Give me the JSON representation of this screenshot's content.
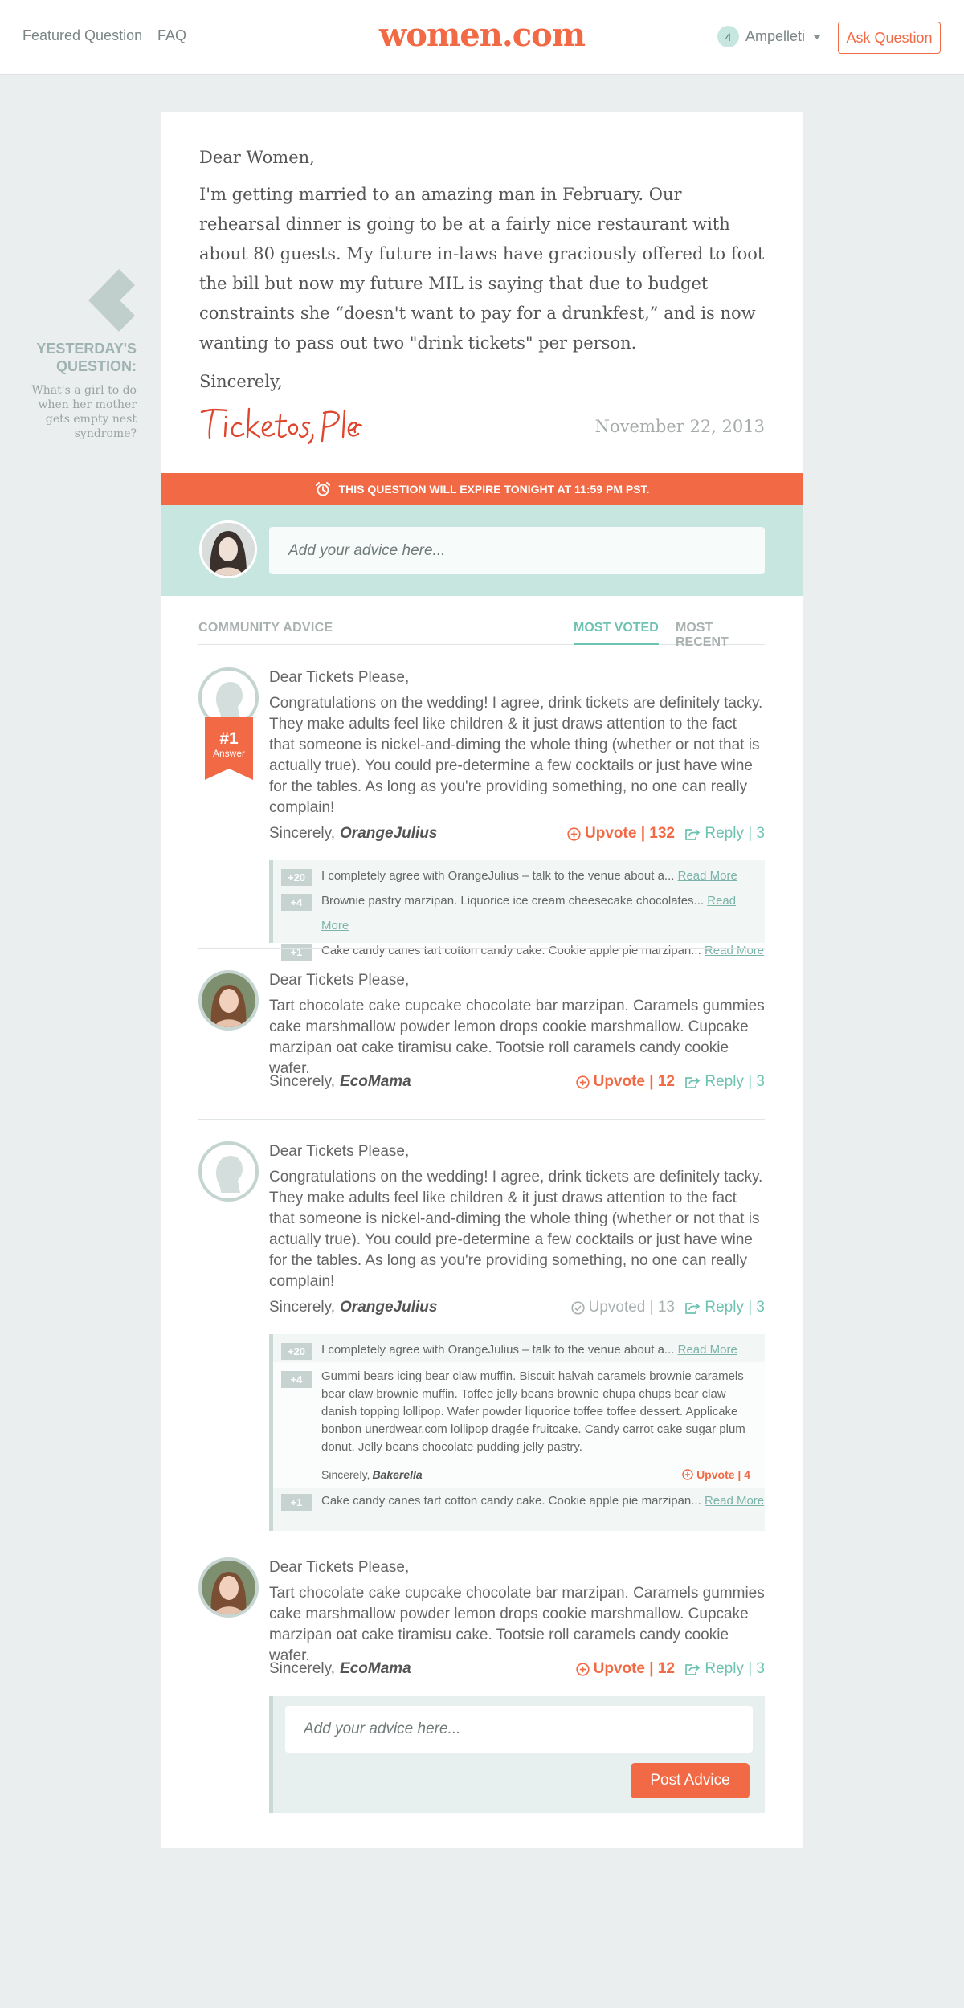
{
  "nav": {
    "featured": "Featured Question",
    "faq": "FAQ",
    "logo": "women.com",
    "user_count": "4",
    "user_name": "Ampelleti",
    "ask": "Ask Question"
  },
  "yesterday": {
    "title": "YESTERDAY'S QUESTION:",
    "text": "What's a girl to do when her mother gets empty nest syndrome?"
  },
  "letter": {
    "greeting": "Dear Women,",
    "body": "I'm getting married to an amazing man in February. Our rehearsal dinner is going to be at a fairly nice restaurant with about 80 guests. My future in-laws have graciously offered to foot the bill but now my future MIL is saying that due to budget constraints she “doesn't want to pay for a drunkfest,” and is now wanting to pass out two \"drink tickets\" per person.",
    "signoff": "Sincerely,",
    "signature": "Tickets, Please",
    "date": "November 22, 2013"
  },
  "expire": "THIS QUESTION WILL EXPIRE TONIGHT AT 11:59 PM PST.",
  "advice_placeholder": "Add your advice here...",
  "community": {
    "title": "COMMUNITY ADVICE",
    "tab_voted": "MOST VOTED",
    "tab_recent": "MOST RECENT"
  },
  "answers": [
    {
      "greeting": "Dear Tickets Please,",
      "body": "Congratulations on the wedding! I agree, drink tickets are definitely tacky. They make adults feel like children & it just draws attention to the fact that someone is nickel-and-diming the whole thing (whether or not that is actually true). You could pre-determine a few cocktails or just have wine for the tables. As long as you're providing something, no one can really complain!",
      "sincerely": "Sincerely,",
      "author": "OrangeJulius",
      "rank_num": "#1",
      "rank_label": "Answer",
      "vote": "Upvote | 132",
      "reply": "Reply | 3",
      "replies": [
        {
          "count": "+20",
          "text": "I completely agree with OrangeJulius – talk to the venue about a...",
          "more": "Read More"
        },
        {
          "count": "+4",
          "text": "Brownie pastry marzipan. Liquorice ice cream cheesecake chocolates...",
          "more": "Read More"
        },
        {
          "count": "+1",
          "text": "Cake candy canes tart cotton candy cake. Cookie apple pie marzipan...",
          "more": "Read More"
        }
      ]
    },
    {
      "greeting": "Dear Tickets Please,",
      "body": "Tart chocolate cake cupcake chocolate bar marzipan. Caramels gummies cake marshmallow powder lemon drops cookie marshmallow. Cupcake marzipan oat cake tiramisu cake. Tootsie roll caramels candy cookie wafer.",
      "sincerely": "Sincerely,",
      "author": "EcoMama",
      "vote": "Upvote | 12",
      "reply": "Reply | 3"
    },
    {
      "greeting": "Dear Tickets Please,",
      "body": "Congratulations on the wedding! I agree, drink tickets are definitely tacky. They make adults feel like children & it just draws attention to the fact that someone is nickel-and-diming the whole thing (whether or not that is actually true). You could pre-determine a few cocktails or just have wine for the tables. As long as you're providing something, no one can really complain!",
      "sincerely": "Sincerely,",
      "author": "OrangeJulius",
      "vote": "Upvoted | 13",
      "reply": "Reply | 3",
      "replies": [
        {
          "count": "+20",
          "text": "I completely agree with OrangeJulius – talk to the venue about a...",
          "more": "Read More"
        },
        {
          "count": "+4",
          "text": "Gummi bears icing bear claw muffin. Biscuit halvah caramels brownie caramels bear claw brownie muffin. Toffee jelly beans brownie chupa chups bear claw danish topping lollipop. Wafer powder liquorice toffee toffee dessert. Applicake bonbon unerdwear.com lollipop dragée fruitcake. Candy carrot cake sugar plum donut. Jelly beans chocolate pudding jelly pastry.",
          "sincerely": "Sincerely,",
          "author": "Bakerella",
          "vote": "Upvote | 4"
        },
        {
          "count": "+1",
          "text": "Cake candy canes tart cotton candy cake. Cookie apple pie marzipan...",
          "more": "Read More"
        }
      ]
    },
    {
      "greeting": "Dear Tickets Please,",
      "body": "Tart chocolate cake cupcake chocolate bar marzipan. Caramels gummies cake marshmallow powder lemon drops cookie marshmallow. Cupcake marzipan oat cake tiramisu cake. Tootsie roll caramels candy cookie wafer.",
      "sincerely": "Sincerely,",
      "author": "EcoMama",
      "vote": "Upvote | 12",
      "reply": "Reply | 3"
    }
  ],
  "reply_form": {
    "placeholder": "Add your advice here...",
    "button": "Post Advice"
  },
  "colors": {
    "accent": "#f26a45",
    "teal": "#6ec2b1",
    "mint": "#c8e6e0",
    "background": "#ebeeee"
  }
}
